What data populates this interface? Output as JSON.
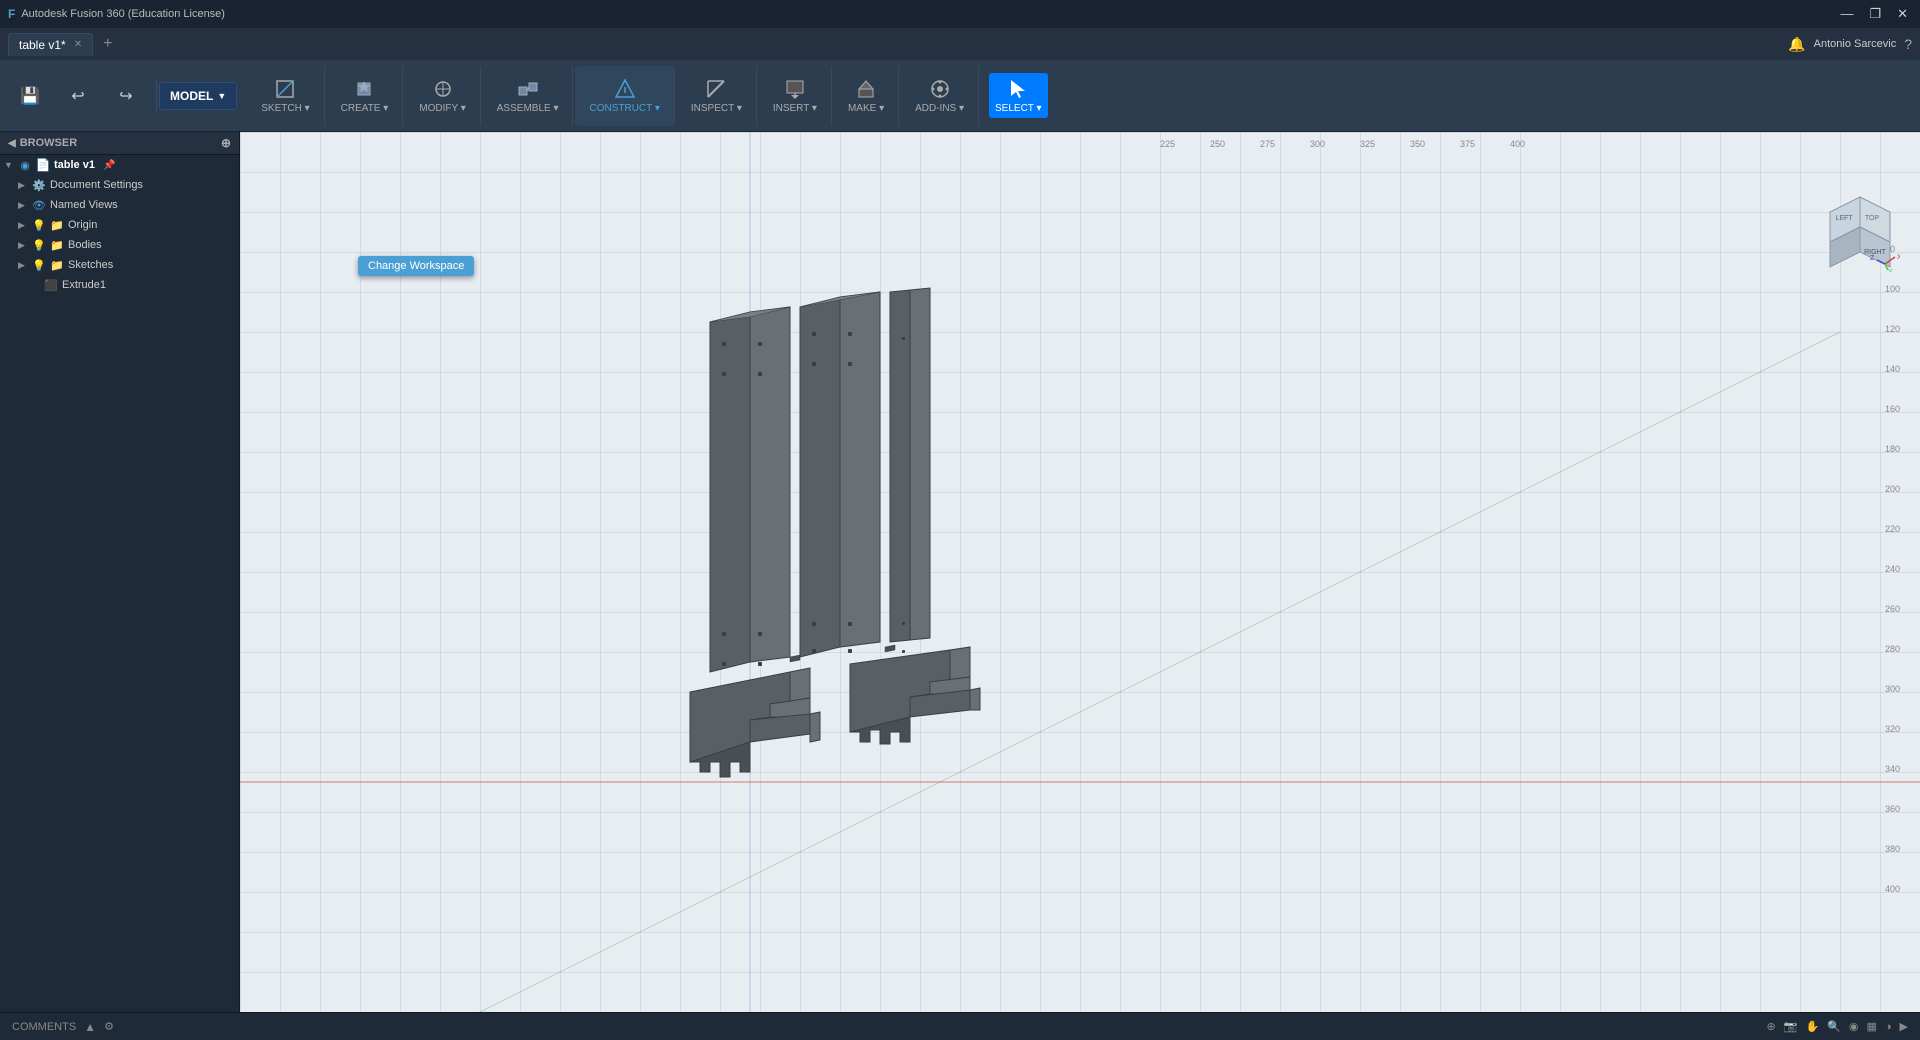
{
  "app": {
    "title": "Autodesk Fusion 360 (Education License)",
    "icon": "F"
  },
  "titlebar": {
    "title": "Autodesk Fusion 360 (Education License)",
    "minimize": "—",
    "restore": "❐",
    "close": "✕"
  },
  "tabs": [
    {
      "label": "table v1*",
      "active": true
    }
  ],
  "toolbar": {
    "workspace_label": "MODEL",
    "sections": [
      {
        "name": "sketch",
        "buttons": [
          {
            "label": "SKETCH",
            "icon": "sketch",
            "has_dropdown": true
          }
        ]
      },
      {
        "name": "create",
        "buttons": [
          {
            "label": "CREATE",
            "icon": "create",
            "has_dropdown": true
          }
        ]
      },
      {
        "name": "modify",
        "buttons": [
          {
            "label": "MODIFY",
            "icon": "modify",
            "has_dropdown": true
          }
        ]
      },
      {
        "name": "assemble",
        "buttons": [
          {
            "label": "ASSEMBLE",
            "icon": "assemble",
            "has_dropdown": true
          }
        ]
      },
      {
        "name": "construct",
        "buttons": [
          {
            "label": "CONSTRUCT",
            "icon": "construct",
            "has_dropdown": true,
            "highlighted": true
          }
        ]
      },
      {
        "name": "inspect",
        "buttons": [
          {
            "label": "INSPECT",
            "icon": "inspect",
            "has_dropdown": true
          }
        ]
      },
      {
        "name": "insert",
        "buttons": [
          {
            "label": "INSERT",
            "icon": "insert",
            "has_dropdown": true
          }
        ]
      },
      {
        "name": "make",
        "buttons": [
          {
            "label": "MAKE",
            "icon": "make",
            "has_dropdown": true
          }
        ]
      },
      {
        "name": "addins",
        "buttons": [
          {
            "label": "ADD-INS",
            "icon": "addins",
            "has_dropdown": true
          }
        ]
      },
      {
        "name": "select",
        "buttons": [
          {
            "label": "SELECT",
            "icon": "select",
            "has_dropdown": true,
            "active": true
          }
        ]
      }
    ]
  },
  "sidebar": {
    "browser_label": "BROWSER",
    "tree": {
      "root": {
        "label": "table v1",
        "children": [
          {
            "label": "Document Settings",
            "icon": "gear",
            "has_children": true
          },
          {
            "label": "Named Views",
            "icon": "eye",
            "has_children": true
          },
          {
            "label": "Origin",
            "icon": "origin",
            "has_children": true
          },
          {
            "label": "Bodies",
            "icon": "folder",
            "has_children": true
          },
          {
            "label": "Sketches",
            "icon": "folder",
            "has_children": true
          },
          {
            "label": "Extrude1",
            "icon": "extrude",
            "has_children": false
          }
        ]
      }
    }
  },
  "tooltip": {
    "text": "Change Workspace"
  },
  "construct_label": "CONSTRUCT >",
  "user": {
    "name": "Antonio Sarcevic"
  },
  "statusbar": {
    "left": "COMMENTS",
    "icons": [
      "comment",
      "expand",
      "settings"
    ]
  },
  "viewport": {
    "background": "#e8edf2",
    "grid_color": "#b8c4d0"
  }
}
